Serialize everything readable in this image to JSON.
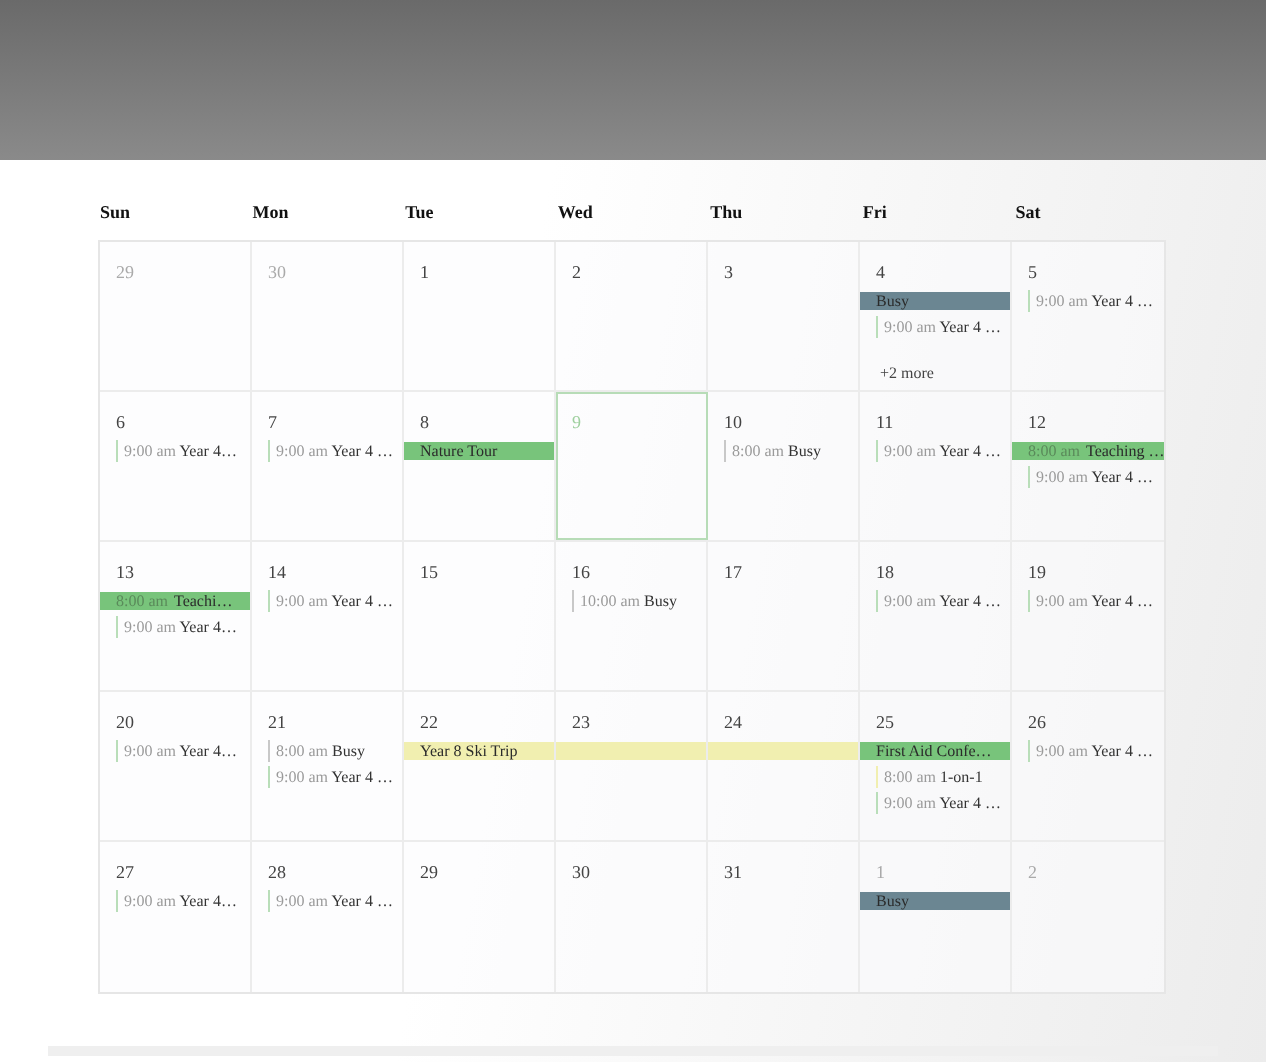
{
  "weekdays": [
    "Sun",
    "Mon",
    "Tue",
    "Wed",
    "Thu",
    "Fri",
    "Sat"
  ],
  "weeks": [
    {
      "days": [
        {
          "day": "29",
          "other_month": true,
          "today": false
        },
        {
          "day": "30",
          "other_month": true,
          "today": false
        },
        {
          "day": "1",
          "other_month": false,
          "today": false
        },
        {
          "day": "2",
          "other_month": false,
          "today": false
        },
        {
          "day": "3",
          "other_month": false,
          "today": false
        },
        {
          "day": "4",
          "other_month": false,
          "today": false,
          "events": [
            {
              "kind": "block",
              "title": "Busy",
              "color": "#6b8692"
            },
            {
              "kind": "timed",
              "time": "9:00 am",
              "title": "Year 4 …",
              "color": "#b9deb9"
            }
          ],
          "more": "+2 more"
        },
        {
          "day": "5",
          "other_month": false,
          "today": false,
          "events": [
            {
              "kind": "timed",
              "time": "9:00 am",
              "title": "Year 4 …",
              "color": "#b9deb9"
            }
          ]
        }
      ]
    },
    {
      "days": [
        {
          "day": "6",
          "other_month": false,
          "today": false,
          "events": [
            {
              "kind": "timed",
              "time": "9:00 am",
              "title": "Year 4…",
              "color": "#b9deb9"
            }
          ]
        },
        {
          "day": "7",
          "other_month": false,
          "today": false,
          "events": [
            {
              "kind": "timed",
              "time": "9:00 am",
              "title": "Year 4 …",
              "color": "#b9deb9"
            }
          ]
        },
        {
          "day": "8",
          "other_month": false,
          "today": false,
          "events": [
            {
              "kind": "block",
              "title": "Nature Tour",
              "color": "#78c47b"
            }
          ]
        },
        {
          "day": "9",
          "other_month": false,
          "today": true
        },
        {
          "day": "10",
          "other_month": false,
          "today": false,
          "events": [
            {
              "kind": "timed",
              "time": "8:00 am",
              "title": "Busy",
              "color": "#c8c8c8"
            }
          ]
        },
        {
          "day": "11",
          "other_month": false,
          "today": false,
          "events": [
            {
              "kind": "timed",
              "time": "9:00 am",
              "title": "Year 4 …",
              "color": "#b9deb9"
            }
          ]
        },
        {
          "day": "12",
          "other_month": false,
          "today": false,
          "events": [
            {
              "kind": "block",
              "time": "8:00 am",
              "title": "Teaching …",
              "color": "#78c47b"
            },
            {
              "kind": "timed",
              "time": "9:00 am",
              "title": "Year 4 …",
              "color": "#b9deb9"
            }
          ]
        }
      ]
    },
    {
      "days": [
        {
          "day": "13",
          "other_month": false,
          "today": false,
          "events": [
            {
              "kind": "block",
              "time": "8:00 am",
              "title": "Teachi…",
              "color": "#78c47b"
            },
            {
              "kind": "timed",
              "time": "9:00 am",
              "title": "Year 4…",
              "color": "#b9deb9"
            }
          ]
        },
        {
          "day": "14",
          "other_month": false,
          "today": false,
          "events": [
            {
              "kind": "timed",
              "time": "9:00 am",
              "title": "Year 4 …",
              "color": "#b9deb9"
            }
          ]
        },
        {
          "day": "15",
          "other_month": false,
          "today": false
        },
        {
          "day": "16",
          "other_month": false,
          "today": false,
          "events": [
            {
              "kind": "timed",
              "time": "10:00 am",
              "title": "Busy",
              "color": "#c8c8c8"
            }
          ]
        },
        {
          "day": "17",
          "other_month": false,
          "today": false
        },
        {
          "day": "18",
          "other_month": false,
          "today": false,
          "events": [
            {
              "kind": "timed",
              "time": "9:00 am",
              "title": "Year 4 …",
              "color": "#b9deb9"
            }
          ]
        },
        {
          "day": "19",
          "other_month": false,
          "today": false,
          "events": [
            {
              "kind": "timed",
              "time": "9:00 am",
              "title": "Year 4 …",
              "color": "#b9deb9"
            }
          ]
        }
      ]
    },
    {
      "days": [
        {
          "day": "20",
          "other_month": false,
          "today": false,
          "events": [
            {
              "kind": "timed",
              "time": "9:00 am",
              "title": "Year 4…",
              "color": "#b9deb9"
            }
          ]
        },
        {
          "day": "21",
          "other_month": false,
          "today": false,
          "events": [
            {
              "kind": "timed",
              "time": "8:00 am",
              "title": "Busy",
              "color": "#c8c8c8"
            },
            {
              "kind": "timed",
              "time": "9:00 am",
              "title": "Year 4 …",
              "color": "#b9deb9"
            }
          ]
        },
        {
          "day": "22",
          "other_month": false,
          "today": false,
          "events": [
            {
              "kind": "span_start",
              "title": "Year 8 Ski Trip",
              "color": "#f1efb0"
            }
          ]
        },
        {
          "day": "23",
          "other_month": false,
          "today": false,
          "events": [
            {
              "kind": "span_continue",
              "color": "#f1efb0"
            }
          ]
        },
        {
          "day": "24",
          "other_month": false,
          "today": false,
          "events": [
            {
              "kind": "span_end",
              "color": "#f1efb0"
            }
          ]
        },
        {
          "day": "25",
          "other_month": false,
          "today": false,
          "events": [
            {
              "kind": "block",
              "title": "First Aid Confe…",
              "color": "#78c47b"
            },
            {
              "kind": "timed",
              "time": "8:00 am",
              "title": "1-on-1",
              "color": "#f1efb0"
            },
            {
              "kind": "timed",
              "time": "9:00 am",
              "title": "Year 4 …",
              "color": "#b9deb9"
            }
          ]
        },
        {
          "day": "26",
          "other_month": false,
          "today": false,
          "events": [
            {
              "kind": "timed",
              "time": "9:00 am",
              "title": "Year 4 …",
              "color": "#b9deb9"
            }
          ]
        }
      ]
    },
    {
      "days": [
        {
          "day": "27",
          "other_month": false,
          "today": false,
          "events": [
            {
              "kind": "timed",
              "time": "9:00 am",
              "title": "Year 4…",
              "color": "#b9deb9"
            }
          ]
        },
        {
          "day": "28",
          "other_month": false,
          "today": false,
          "events": [
            {
              "kind": "timed",
              "time": "9:00 am",
              "title": "Year 4 …",
              "color": "#b9deb9"
            }
          ]
        },
        {
          "day": "29",
          "other_month": false,
          "today": false
        },
        {
          "day": "30",
          "other_month": false,
          "today": false
        },
        {
          "day": "31",
          "other_month": false,
          "today": false
        },
        {
          "day": "1",
          "other_month": true,
          "today": false,
          "events": [
            {
              "kind": "block",
              "title": "Busy",
              "color": "#6b8692"
            }
          ]
        },
        {
          "day": "2",
          "other_month": true,
          "today": false
        }
      ]
    }
  ]
}
